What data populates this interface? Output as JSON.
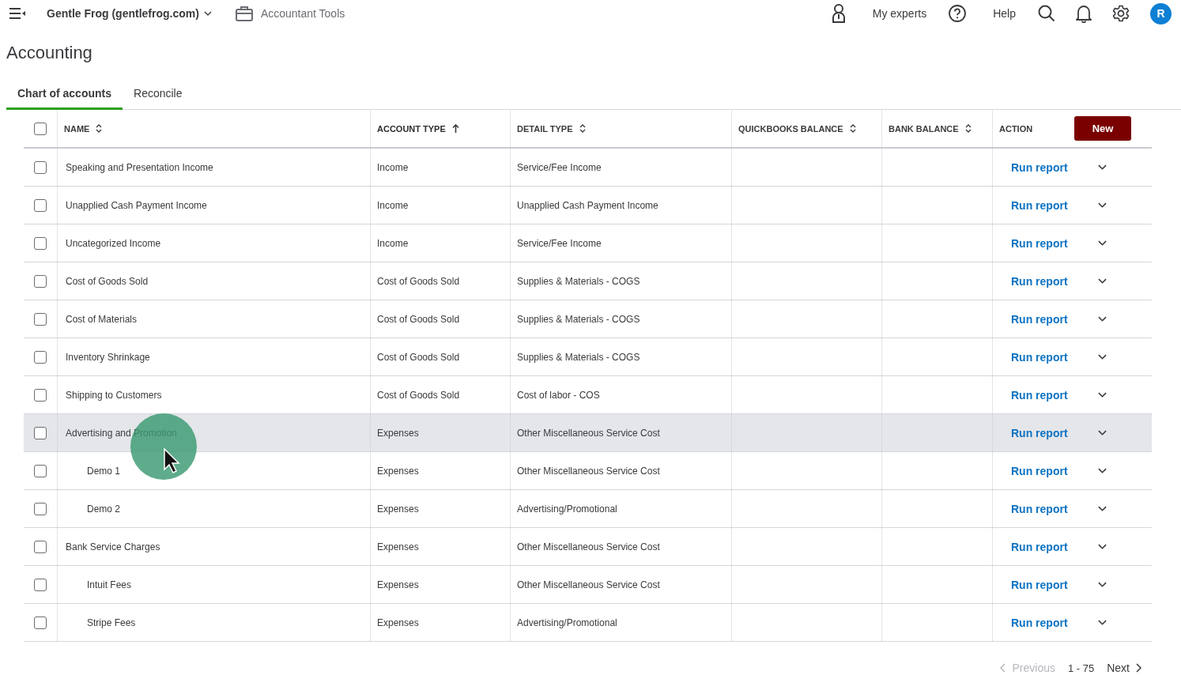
{
  "top_bar": {
    "company": "Gentle Frog (gentlefrog.com)",
    "tools": "Accountant Tools",
    "experts": "My experts",
    "help": "Help",
    "avatar": "R"
  },
  "page_title": "Accounting",
  "tabs": [
    {
      "label": "Chart of accounts",
      "selected": true
    },
    {
      "label": "Reconcile",
      "selected": false
    }
  ],
  "table": {
    "select_all_checked": false,
    "new_button": "New",
    "columns": [
      {
        "label": "NAME",
        "sortable": true,
        "sorted_ascending": false
      },
      {
        "label": "ACCOUNT TYPE",
        "sortable": true,
        "sorted_ascending": true
      },
      {
        "label": "DETAIL TYPE",
        "sortable": true,
        "sorted_ascending": false
      },
      {
        "label": "QUICKBOOKS BALANCE",
        "sortable": true,
        "sorted_ascending": false
      },
      {
        "label": "BANK BALANCE",
        "sortable": true,
        "sorted_ascending": false
      },
      {
        "label": "ACTION",
        "sortable": false,
        "sorted_ascending": false
      }
    ],
    "rows": [
      {
        "name": "Speaking and Presentation Income",
        "account_type": "Income",
        "detail_type": "Service/Fee Income",
        "action": "Run report",
        "checked": false,
        "highlighted": false
      },
      {
        "name": "Unapplied Cash Payment Income",
        "account_type": "Income",
        "detail_type": "Unapplied Cash Payment Income",
        "action": "Run report",
        "checked": false,
        "highlighted": false
      },
      {
        "name": "Uncategorized Income",
        "account_type": "Income",
        "detail_type": "Service/Fee Income",
        "action": "Run report",
        "checked": false,
        "highlighted": false
      },
      {
        "name": "Cost of Goods Sold",
        "account_type": "Cost of Goods Sold",
        "detail_type": "Supplies & Materials - COGS",
        "action": "Run report",
        "checked": false,
        "highlighted": false
      },
      {
        "name": "Cost of Materials",
        "account_type": "Cost of Goods Sold",
        "detail_type": "Supplies & Materials - COGS",
        "action": "Run report",
        "checked": false,
        "highlighted": false
      },
      {
        "name": "Inventory Shrinkage",
        "account_type": "Cost of Goods Sold",
        "detail_type": "Supplies & Materials - COGS",
        "action": "Run report",
        "checked": false,
        "highlighted": false
      },
      {
        "name": "Shipping to Customers",
        "account_type": "Cost of Goods Sold",
        "detail_type": "Cost of labor - COS",
        "action": "Run report",
        "checked": false,
        "highlighted": false
      },
      {
        "name": "Advertising and Promotion",
        "account_type": "Expenses",
        "detail_type": "Other Miscellaneous Service Cost",
        "action": "Run report",
        "checked": false,
        "highlighted": true,
        "children": [
          {
            "name": "Demo 1",
            "account_type": "Expenses",
            "detail_type": "Other Miscellaneous Service Cost",
            "action": "Run report",
            "checked": false,
            "highlighted": false
          },
          {
            "name": "Demo 2",
            "account_type": "Expenses",
            "detail_type": "Advertising/Promotional",
            "action": "Run report",
            "checked": false,
            "highlighted": false
          }
        ]
      },
      {
        "name": "Bank Service Charges",
        "account_type": "Expenses",
        "detail_type": "Other Miscellaneous Service Cost",
        "action": "Run report",
        "checked": false,
        "highlighted": false,
        "children": [
          {
            "name": "Intuit Fees",
            "account_type": "Expenses",
            "detail_type": "Other Miscellaneous Service Cost",
            "action": "Run report",
            "checked": false,
            "highlighted": false
          },
          {
            "name": "Stripe Fees",
            "account_type": "Expenses",
            "detail_type": "Advertising/Promotional",
            "action": "Run report",
            "checked": false,
            "highlighted": false
          }
        ]
      }
    ]
  },
  "pagination": {
    "previous": "Previous",
    "previous_disabled": true,
    "range": "1 - 75",
    "next": "Next"
  }
}
